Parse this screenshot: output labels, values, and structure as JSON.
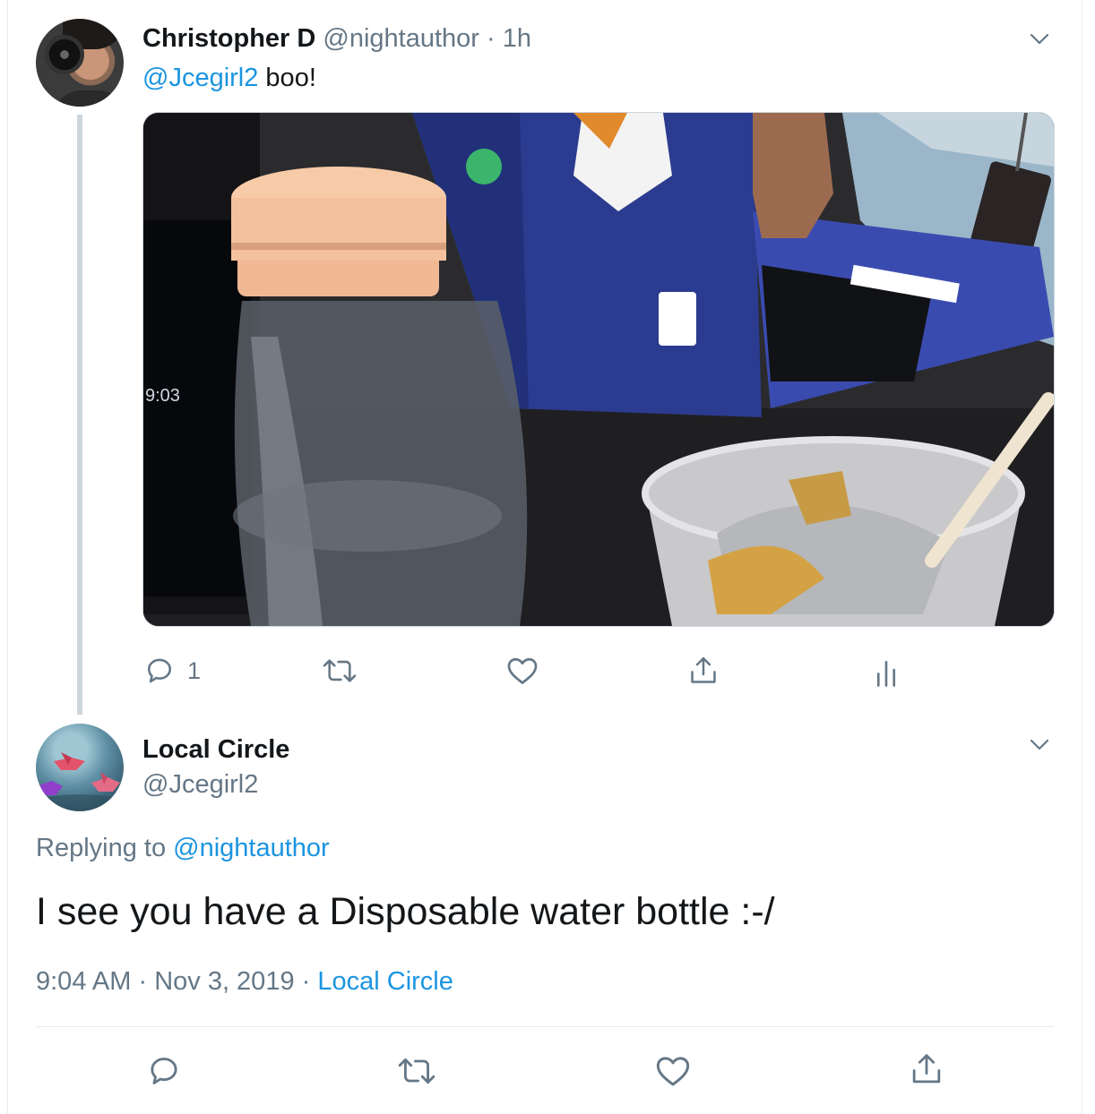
{
  "tweet1": {
    "author_name": "Christopher D",
    "author_handle": "@nightauthor",
    "separator": "·",
    "time_ago": "1h",
    "reply_mention": "@Jcegirl2",
    "text": " boo!",
    "photo_icons": [
      "water-bottle",
      "laptop",
      "cup-with-foil"
    ],
    "actions": {
      "reply_count": "1",
      "retweet_count": "",
      "like_count": ""
    }
  },
  "tweet2": {
    "author_name": "Local Circle",
    "author_handle": "@Jcegirl2",
    "replying_label": "Replying to ",
    "replying_to": "@nightauthor",
    "text": "I see you have a Disposable water bottle :-/",
    "time": "9:04 AM",
    "date_separator": " · ",
    "date": "Nov 3, 2019",
    "source_separator": " · ",
    "source": "Local Circle"
  },
  "colors": {
    "accent": "#1b95e0",
    "secondary_text": "#657786",
    "primary_text": "#14171a",
    "border": "#e6ecf0",
    "thread_line": "#ccd6dd"
  }
}
